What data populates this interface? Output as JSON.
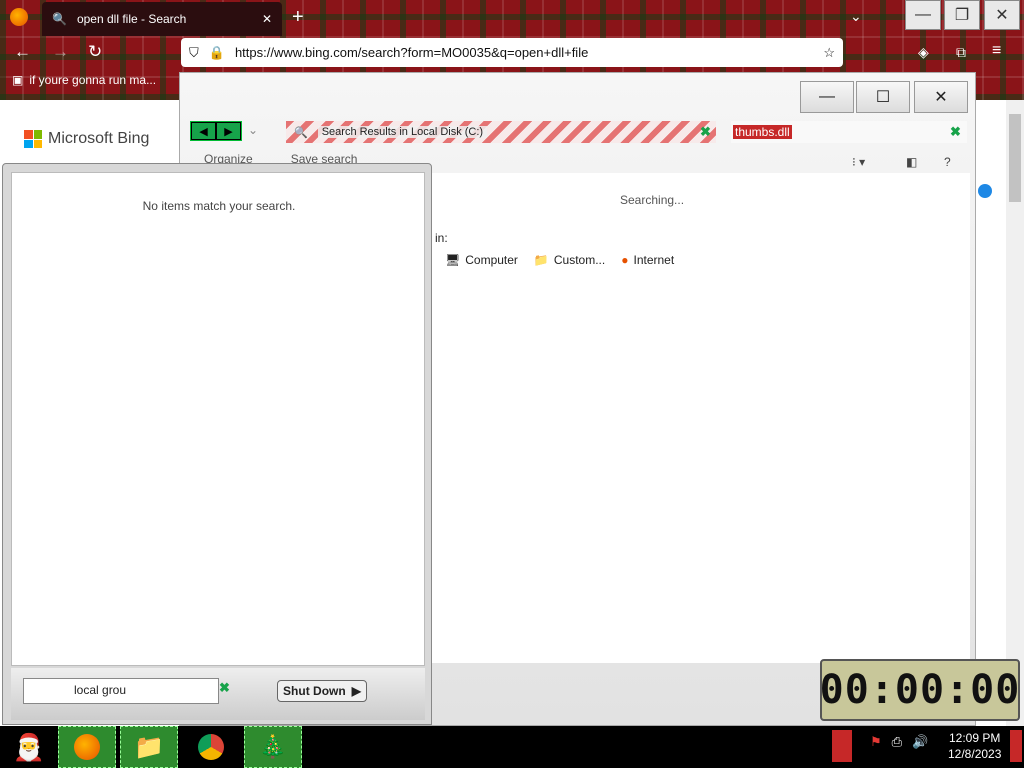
{
  "browser": {
    "tab_title": "open dll file - Search",
    "url": "https://www.bing.com/search?form=MO0035&q=open+dll+file",
    "bookmark": "if youre gonna run ma..."
  },
  "bing": {
    "logo_text": "Microsoft Bing"
  },
  "explorer": {
    "address_text": "Search Results in Local Disk (C:)",
    "search_query": "thumbs.dll",
    "toolbar": {
      "organize": "Organize",
      "save_search": "Save search"
    },
    "status": "Searching...",
    "search_again_label": "in:",
    "locations": [
      "Computer",
      "Custom...",
      "Internet"
    ]
  },
  "start_panel": {
    "empty_message": "No items match your search.",
    "search_value": "local grou",
    "shutdown_label": "Shut Down"
  },
  "clock_widget": {
    "display": "00:00:00"
  },
  "taskbar": {
    "time": "12:09 PM",
    "date": "12/8/2023"
  },
  "colors": {
    "plaid_red": "#8a1418",
    "explorer_green": "#16a34a",
    "query_highlight": "#c62828"
  }
}
